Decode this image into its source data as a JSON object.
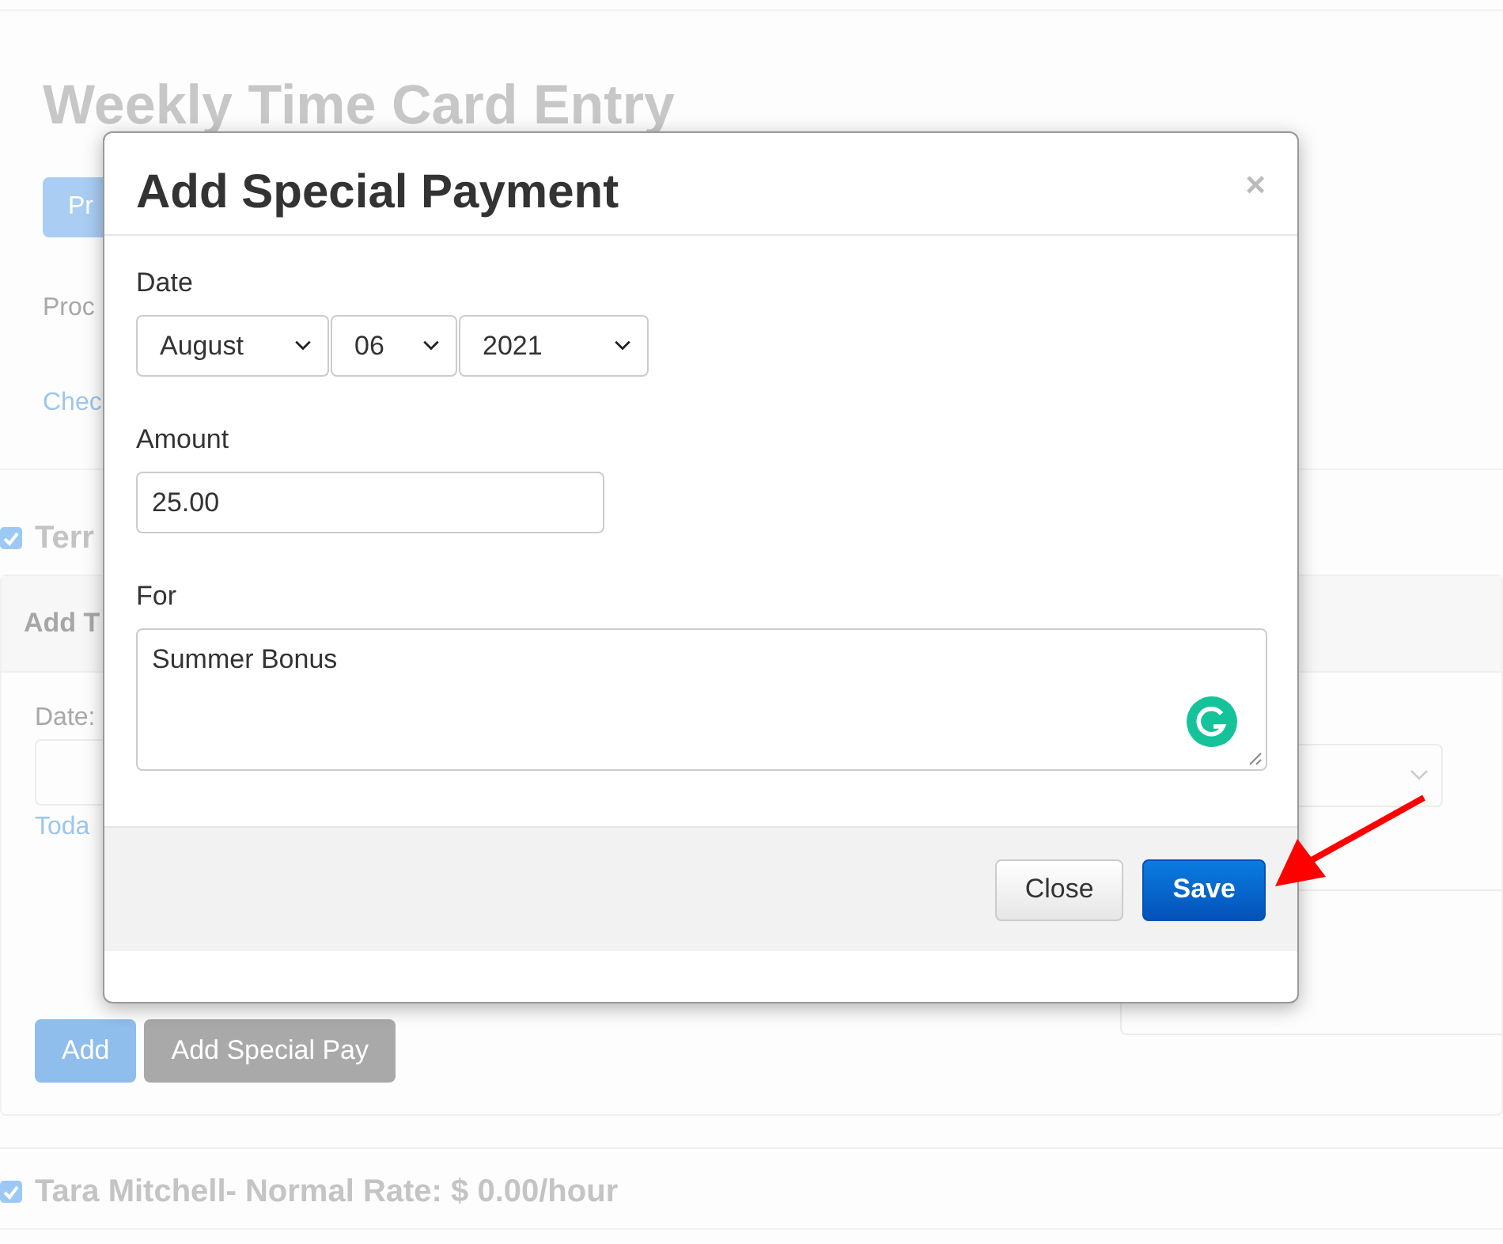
{
  "page": {
    "title": "Weekly Time Card Entry",
    "primary_button": "Pr",
    "process_text": "Proc",
    "check_link": "Chec"
  },
  "employees": [
    {
      "heading": "Terr",
      "checked": true,
      "panel": {
        "title": "Add T",
        "date_label": "Date:",
        "today_link": "Toda",
        "buttons": [
          {
            "label": "Add",
            "kind": "primary"
          },
          {
            "label": "Add Special Pay",
            "kind": "secondary"
          }
        ]
      }
    },
    {
      "heading": "Tara Mitchell- Normal Rate: $ 0.00/hour",
      "checked": true
    }
  ],
  "modal": {
    "title": "Add Special Payment",
    "close": "×",
    "date_label": "Date",
    "date_selects": [
      {
        "value": "August",
        "kind": "month"
      },
      {
        "value": "06",
        "kind": "day"
      },
      {
        "value": "2021",
        "kind": "year"
      }
    ],
    "amount_label": "Amount",
    "amount_value": "25.00",
    "for_label": "For",
    "for_value": "Summer Bonus",
    "buttons": [
      {
        "label": "Close",
        "kind": "default"
      },
      {
        "label": "Save",
        "kind": "primary"
      }
    ]
  }
}
